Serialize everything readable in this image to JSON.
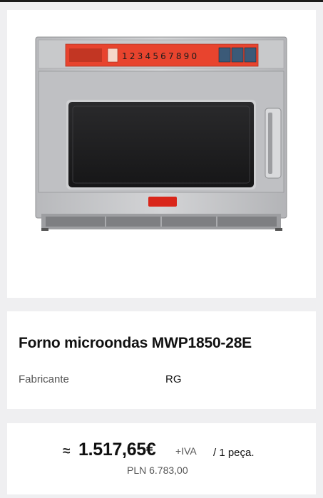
{
  "product": {
    "image_alt": "Forno microondas MWP1850-28E",
    "panel_digits": "1234567890",
    "brand_badge": "RG",
    "title": "Forno microondas MWP1850-28E",
    "specs": [
      {
        "label": "Fabricante",
        "value": "RG"
      }
    ]
  },
  "price": {
    "approx_symbol": "≈",
    "amount": "1.517,65€",
    "vat": "+IVA",
    "unit": "/ 1 peça.",
    "secondary": "PLN 6.783,00"
  },
  "colors": {
    "background": "#efeff1",
    "card": "#ffffff",
    "panel_red": "#e8442e"
  }
}
